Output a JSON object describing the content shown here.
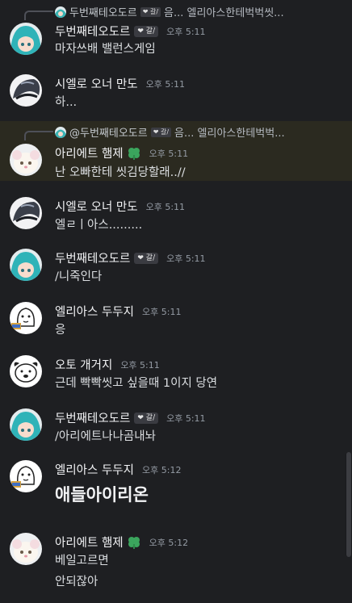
{
  "messages": [
    {
      "author": "두번째테오도르",
      "badge": "❤ 갈/",
      "time": "오후 5:11",
      "text": "마자쓰배 밸런스게임",
      "reply": {
        "author": "두번째테오도르",
        "badge": "❤ 갈/",
        "text": "음... 엘리아스한테벅벅씻..."
      }
    },
    {
      "author": "시엘로 오너 만도",
      "time": "오후 5:11",
      "text": "하..."
    },
    {
      "author": "아리에트 햄제",
      "time": "오후 5:11",
      "text": "난 오빠한테 씻김당할래..//",
      "reply": {
        "author": "@두번째테오도르",
        "badge": "❤ 갈/",
        "text": "음... 엘리아스한테벅벅..."
      }
    },
    {
      "author": "시엘로 오너 만도",
      "time": "오후 5:11",
      "text": "엘ㄹㅣ아스........."
    },
    {
      "author": "두번째테오도르",
      "badge": "❤ 갈/",
      "time": "오후 5:11",
      "text": "/니죽인다"
    },
    {
      "author": "엘리아스 두두지",
      "time": "오후 5:11",
      "text": "응"
    },
    {
      "author": "오토 개거지",
      "time": "오후 5:11",
      "text": "근데 빡빡씻고 싶을때 1이지 당연"
    },
    {
      "author": "두번째테오도르",
      "badge": "❤ 갈/",
      "time": "오후 5:11",
      "text": "/아리에트나나곰내놔"
    },
    {
      "author": "엘리아스 두두지",
      "time": "오후 5:12",
      "text": "애들아이리온"
    },
    {
      "author": "아리에트 햄제",
      "time": "오후 5:12",
      "text": "베일고르면",
      "text2": "안되잖아"
    }
  ],
  "colors": {
    "background": "#1e1f22",
    "highlight": "#2b2a20",
    "clover": "#3ba55d"
  }
}
